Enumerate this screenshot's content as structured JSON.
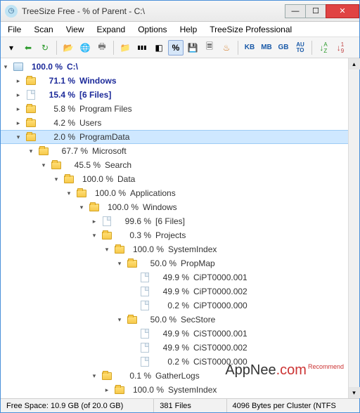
{
  "title": "TreeSize Free - % of Parent - C:\\",
  "menu": [
    "File",
    "Scan",
    "View",
    "Expand",
    "Options",
    "Help",
    "TreeSize Professional"
  ],
  "toolbar": {
    "size_units": [
      "KB",
      "MB",
      "GB"
    ],
    "auto": "AU\nTO"
  },
  "tree": [
    {
      "d": 0,
      "e": "▾",
      "i": "drive",
      "p": "100.0 %",
      "n": "C:\\",
      "cls": "bold",
      "sel": false
    },
    {
      "d": 1,
      "e": "▸",
      "i": "folder",
      "p": "71.1 %",
      "n": "Windows",
      "cls": "bold",
      "sel": false
    },
    {
      "d": 1,
      "e": "▸",
      "i": "file",
      "p": "15.4 %",
      "n": "[6 Files]",
      "cls": "bold",
      "sel": false
    },
    {
      "d": 1,
      "e": "▸",
      "i": "folder",
      "p": "5.8 %",
      "n": "Program Files",
      "cls": "dim",
      "sel": false
    },
    {
      "d": 1,
      "e": "▸",
      "i": "folder",
      "p": "4.2 %",
      "n": "Users",
      "cls": "dim",
      "sel": false
    },
    {
      "d": 1,
      "e": "▾",
      "i": "folder",
      "p": "2.0 %",
      "n": "ProgramData",
      "cls": "dim",
      "sel": true
    },
    {
      "d": 2,
      "e": "▾",
      "i": "folder",
      "p": "67.7 %",
      "n": "Microsoft",
      "cls": "dim",
      "sel": false
    },
    {
      "d": 3,
      "e": "▾",
      "i": "folder",
      "p": "45.5 %",
      "n": "Search",
      "cls": "dim",
      "sel": false
    },
    {
      "d": 4,
      "e": "▾",
      "i": "folder",
      "p": "100.0 %",
      "n": "Data",
      "cls": "dim",
      "sel": false
    },
    {
      "d": 5,
      "e": "▾",
      "i": "folder",
      "p": "100.0 %",
      "n": "Applications",
      "cls": "dim",
      "sel": false
    },
    {
      "d": 6,
      "e": "▾",
      "i": "folder",
      "p": "100.0 %",
      "n": "Windows",
      "cls": "dim",
      "sel": false
    },
    {
      "d": 7,
      "e": "▸",
      "i": "file",
      "p": "99.6 %",
      "n": "[6 Files]",
      "cls": "dim",
      "sel": false
    },
    {
      "d": 7,
      "e": "▾",
      "i": "folder",
      "p": "0.3 %",
      "n": "Projects",
      "cls": "dim",
      "sel": false
    },
    {
      "d": 8,
      "e": "▾",
      "i": "folder",
      "p": "100.0 %",
      "n": "SystemIndex",
      "cls": "dim",
      "sel": false
    },
    {
      "d": 9,
      "e": "▾",
      "i": "folder",
      "p": "50.0 %",
      "n": "PropMap",
      "cls": "dim",
      "sel": false
    },
    {
      "d": 10,
      "e": "",
      "i": "file",
      "p": "49.9 %",
      "n": "CiPT0000.001",
      "cls": "dim",
      "sel": false
    },
    {
      "d": 10,
      "e": "",
      "i": "file",
      "p": "49.9 %",
      "n": "CiPT0000.002",
      "cls": "dim",
      "sel": false
    },
    {
      "d": 10,
      "e": "",
      "i": "file",
      "p": "0.2 %",
      "n": "CiPT0000.000",
      "cls": "dim",
      "sel": false
    },
    {
      "d": 9,
      "e": "▾",
      "i": "folder",
      "p": "50.0 %",
      "n": "SecStore",
      "cls": "dim",
      "sel": false
    },
    {
      "d": 10,
      "e": "",
      "i": "file",
      "p": "49.9 %",
      "n": "CiST0000.001",
      "cls": "dim",
      "sel": false
    },
    {
      "d": 10,
      "e": "",
      "i": "file",
      "p": "49.9 %",
      "n": "CiST0000.002",
      "cls": "dim",
      "sel": false
    },
    {
      "d": 10,
      "e": "",
      "i": "file",
      "p": "0.2 %",
      "n": "CiST0000.000",
      "cls": "dim",
      "sel": false
    },
    {
      "d": 7,
      "e": "▾",
      "i": "folder",
      "p": "0.1 %",
      "n": "GatherLogs",
      "cls": "dim",
      "sel": false
    },
    {
      "d": 8,
      "e": "▸",
      "i": "folder",
      "p": "100.0 %",
      "n": "SystemIndex",
      "cls": "dim",
      "sel": false
    }
  ],
  "status": {
    "free": "Free Space: 10.9 GB  (of 20.0 GB)",
    "files": "381 Files",
    "cluster": "4096 Bytes per Cluster (NTFS"
  },
  "watermark": {
    "a": "AppNee",
    "b": ".com",
    "sup": "Recommend"
  }
}
